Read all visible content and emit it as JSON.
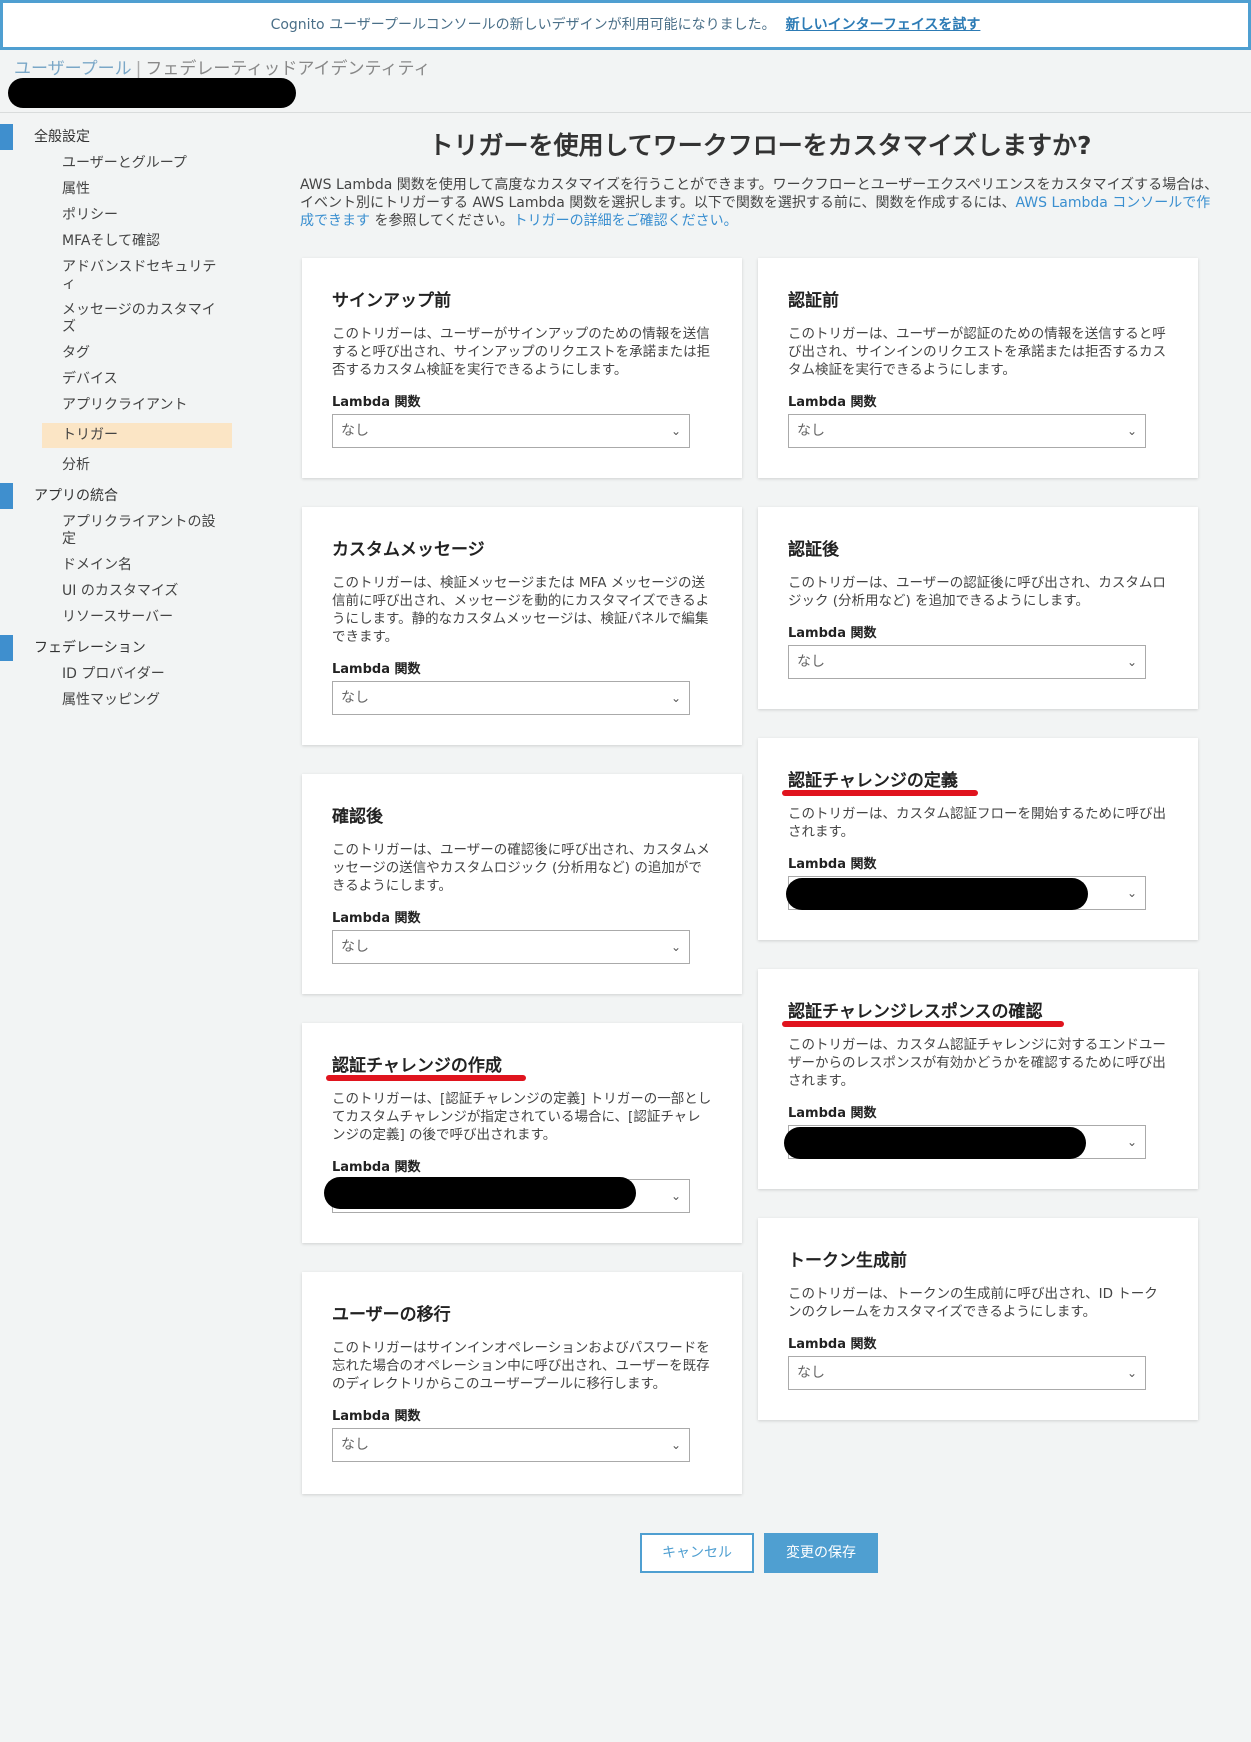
{
  "banner": {
    "text": "Cognito ユーザープールコンソールの新しいデザインが利用可能になりました。",
    "link": "新しいインターフェイスを試す"
  },
  "breadcrumb": {
    "pools": "ユーザープール",
    "sep": "|",
    "federated": "フェデレーティッドアイデンティティ"
  },
  "sidebar": {
    "general": {
      "label": "全般設定",
      "items": [
        "ユーザーとグループ",
        "属性",
        "ポリシー",
        "MFAそして確認",
        "アドバンスドセキュリティ",
        "メッセージのカスタマイズ",
        "タグ",
        "デバイス",
        "アプリクライアント",
        "トリガー",
        "分析"
      ]
    },
    "app": {
      "label": "アプリの統合",
      "items": [
        "アプリクライアントの設定",
        "ドメイン名",
        "UI のカスタマイズ",
        "リソースサーバー"
      ]
    },
    "federation": {
      "label": "フェデレーション",
      "items": [
        "ID プロバイダー",
        "属性マッピング"
      ]
    }
  },
  "main": {
    "title": "トリガーを使用してワークフローをカスタマイズしますか?",
    "desc_text": "AWS Lambda 関数を使用して高度なカスタマイズを行うことができます。ワークフローとユーザーエクスペリエンスをカスタマイズする場合は、イベント別にトリガーする AWS Lambda 関数を選択します。以下で関数を選択する前に、関数を作成するには、",
    "desc_link1": "AWS Lambda コンソールで作成できます",
    "desc_mid": " を参照してください。",
    "desc_link2": "トリガーの詳細をご確認ください。"
  },
  "lambda_label": "Lambda 関数",
  "select_none": "なし",
  "triggers": {
    "pre_signup": {
      "title": "サインアップ前",
      "desc": "このトリガーは、ユーザーがサインアップのための情報を送信すると呼び出され、サインアップのリクエストを承諾または拒否するカスタム検証を実行できるようにします。"
    },
    "custom_message": {
      "title": "カスタムメッセージ",
      "desc": "このトリガーは、検証メッセージまたは MFA メッセージの送信前に呼び出され、メッセージを動的にカスタマイズできるようにします。静的なカスタムメッセージは、検証パネルで編集できます。"
    },
    "post_confirmation": {
      "title": "確認後",
      "desc": "このトリガーは、ユーザーの確認後に呼び出され、カスタムメッセージの送信やカスタムロジック (分析用など) の追加ができるようにします。"
    },
    "create_challenge": {
      "title": "認証チャレンジの作成",
      "desc": "このトリガーは、[認証チャレンジの定義] トリガーの一部としてカスタムチャレンジが指定されている場合に、[認証チャレンジの定義] の後で呼び出されます。"
    },
    "user_migration": {
      "title": "ユーザーの移行",
      "desc": "このトリガーはサインインオペレーションおよびパスワードを忘れた場合のオペレーション中に呼び出され、ユーザーを既存のディレクトリからこのユーザープールに移行します。"
    },
    "pre_auth": {
      "title": "認証前",
      "desc": "このトリガーは、ユーザーが認証のための情報を送信すると呼び出され、サインインのリクエストを承諾または拒否するカスタム検証を実行できるようにします。"
    },
    "post_auth": {
      "title": "認証後",
      "desc": "このトリガーは、ユーザーの認証後に呼び出され、カスタムロジック (分析用など) を追加できるようにします。"
    },
    "define_challenge": {
      "title": "認証チャレンジの定義",
      "desc": "このトリガーは、カスタム認証フローを開始するために呼び出されます。"
    },
    "verify_challenge": {
      "title": "認証チャレンジレスポンスの確認",
      "desc": "このトリガーは、カスタム認証チャレンジに対するエンドユーザーからのレスポンスが有効かどうかを確認するために呼び出されます。"
    },
    "pre_token": {
      "title": "トークン生成前",
      "desc": "このトリガーは、トークンの生成前に呼び出され、ID トークンのクレームをカスタマイズできるようにします。"
    }
  },
  "buttons": {
    "cancel": "キャンセル",
    "save": "変更の保存"
  },
  "colors": {
    "accent": "#4f9fd1",
    "active_bg": "#fbe5c5",
    "annotation": "#e0141e"
  }
}
